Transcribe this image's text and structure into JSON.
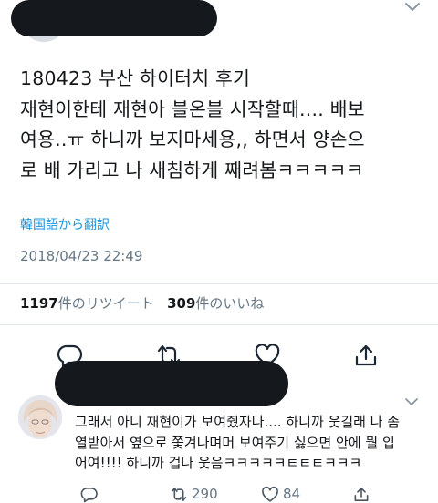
{
  "tweet": {
    "text": "180423 부산 하이터치 후기\n재현이한테 재현아 블온블 시작할때.... 배보\n여용..ㅠ 하니까 보지마세용,, 하면서 양손으\n로 배 가리고 나 새침하게 째려봄ㅋㅋㅋㅋㅋ",
    "translate": "韓国語から翻訳",
    "timestamp": "2018/04/23 22:49",
    "retweet_count": "1197",
    "retweet_label": "件のリツイート",
    "like_count": "309",
    "like_label": "件のいいね"
  },
  "reply": {
    "text": "그래서 아니 재현이가 보여줬자나.... 하니까 웃길래 나 좀\n열받아서 옆으로 쫓겨나며머 보여주기 싫으면 안에 뭘 입\n어여!!!! 하니까 겁나 웃음ㅋㅋㅋㅋㅋㅌㅌㅌㅋㅋㅋ",
    "retweets": "290",
    "likes": "84"
  },
  "icons": {
    "reply": "reply-icon",
    "retweet": "retweet-icon",
    "like": "heart-icon",
    "share": "share-icon",
    "chevron": "chevron-down-icon"
  },
  "colors": {
    "text": "#14171a",
    "muted": "#657786",
    "link": "#1b95e0",
    "redaction": "#15181c"
  }
}
